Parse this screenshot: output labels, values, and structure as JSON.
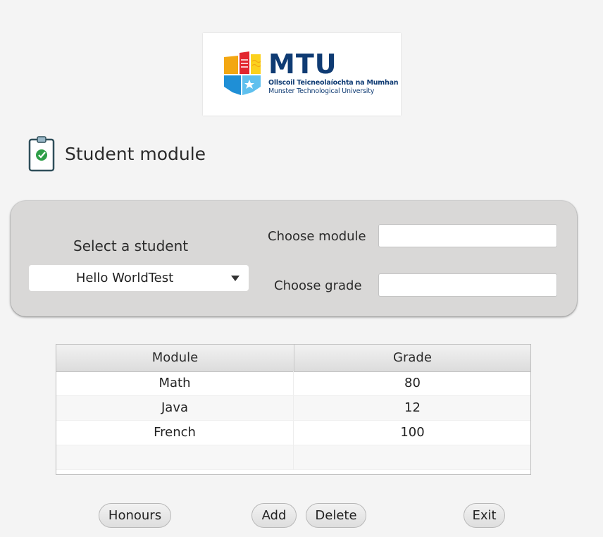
{
  "logo": {
    "wordmark": "MTU",
    "line1": "Ollscoil Teicneolaíochta na Mumhan",
    "line2": "Munster Technological University"
  },
  "page": {
    "title": "Student module",
    "title_icon": "clipboard-check-icon"
  },
  "form": {
    "select_label": "Select a student",
    "selected_student": "Hello WorldTest",
    "module_label": "Choose module",
    "module_value": "",
    "grade_label": "Choose grade",
    "grade_value": ""
  },
  "table": {
    "columns": [
      "Module",
      "Grade"
    ],
    "rows": [
      {
        "module": "Math",
        "grade": "80"
      },
      {
        "module": "Java",
        "grade": "12"
      },
      {
        "module": "French",
        "grade": "100"
      }
    ]
  },
  "buttons": {
    "honours": "Honours",
    "add": "Add",
    "delete": "Delete",
    "exit": "Exit"
  },
  "colors": {
    "background": "#f4f4f4",
    "panel": "#d9d8d7",
    "brand_blue": "#0f3b73",
    "check_green": "#2e9e48"
  }
}
